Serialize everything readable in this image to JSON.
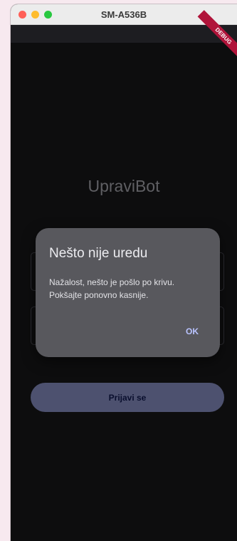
{
  "window": {
    "title": "SM-A536B"
  },
  "debug_banner": "DEBUG",
  "app": {
    "title": "UpraviBot",
    "login_button": "Prijavi se"
  },
  "dialog": {
    "title": "Nešto nije uredu",
    "message_line1": "Nažalost, nešto je pošlo po krivu.",
    "message_line2": "Pokšajte ponovno kasnije.",
    "ok_label": "OK"
  },
  "colors": {
    "background": "#151518",
    "button": "#7c84b4",
    "dialog": "#58585d",
    "accent_text": "#b9c3ff",
    "debug_banner": "#b0143a"
  }
}
